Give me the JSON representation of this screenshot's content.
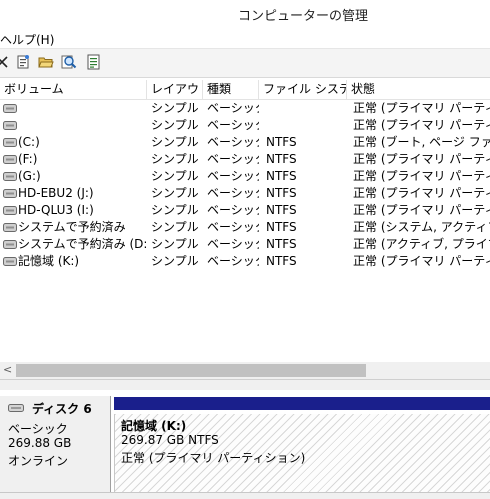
{
  "window": {
    "title": "コンピューターの管理"
  },
  "menu": {
    "help": "ヘルプ(H)"
  },
  "toolbar": {
    "buttons": [
      "close-icon",
      "properties-icon",
      "open-folder-icon",
      "search-icon",
      "export-list-icon"
    ]
  },
  "table": {
    "columns": [
      "ボリューム",
      "レイアウト",
      "種類",
      "ファイル システム",
      "状態"
    ],
    "rows": [
      {
        "volume": "",
        "layout": "シンプル",
        "type": "ベーシック",
        "fs": "",
        "status": "正常 (プライマリ パーティション"
      },
      {
        "volume": "",
        "layout": "シンプル",
        "type": "ベーシック",
        "fs": "",
        "status": "正常 (プライマリ パーティション"
      },
      {
        "volume": "(C:)",
        "layout": "シンプル",
        "type": "ベーシック",
        "fs": "NTFS",
        "status": "正常 (ブート, ページ ファイル"
      },
      {
        "volume": "(F:)",
        "layout": "シンプル",
        "type": "ベーシック",
        "fs": "NTFS",
        "status": "正常 (プライマリ パーティション"
      },
      {
        "volume": "(G:)",
        "layout": "シンプル",
        "type": "ベーシック",
        "fs": "NTFS",
        "status": "正常 (プライマリ パーティション"
      },
      {
        "volume": "HD-EBU2 (J:)",
        "layout": "シンプル",
        "type": "ベーシック",
        "fs": "NTFS",
        "status": "正常 (プライマリ パーティション"
      },
      {
        "volume": "HD-QLU3 (I:)",
        "layout": "シンプル",
        "type": "ベーシック",
        "fs": "NTFS",
        "status": "正常 (プライマリ パーティション"
      },
      {
        "volume": "システムで予約済み",
        "layout": "シンプル",
        "type": "ベーシック",
        "fs": "NTFS",
        "status": "正常 (システム, アクティブ, プ"
      },
      {
        "volume": "システムで予約済み (D:)",
        "layout": "シンプル",
        "type": "ベーシック",
        "fs": "NTFS",
        "status": "正常 (アクティブ, プライマリ パ"
      },
      {
        "volume": "記憶域 (K:)",
        "layout": "シンプル",
        "type": "ベーシック",
        "fs": "NTFS",
        "status": "正常 (プライマリ パーティション"
      }
    ]
  },
  "scroll": {
    "left_arrow": "<"
  },
  "disk": {
    "name": "ディスク 6",
    "kind": "ベーシック",
    "size": "269.88 GB",
    "state": "オンライン",
    "partition": {
      "name": "記憶域  (K:)",
      "size": "269.87 GB NTFS",
      "status": "正常 (プライマリ パーティション)"
    }
  },
  "colors": {
    "partition_bar": "#1a1f8c",
    "toolbar_bg": "#f4f4f4"
  }
}
